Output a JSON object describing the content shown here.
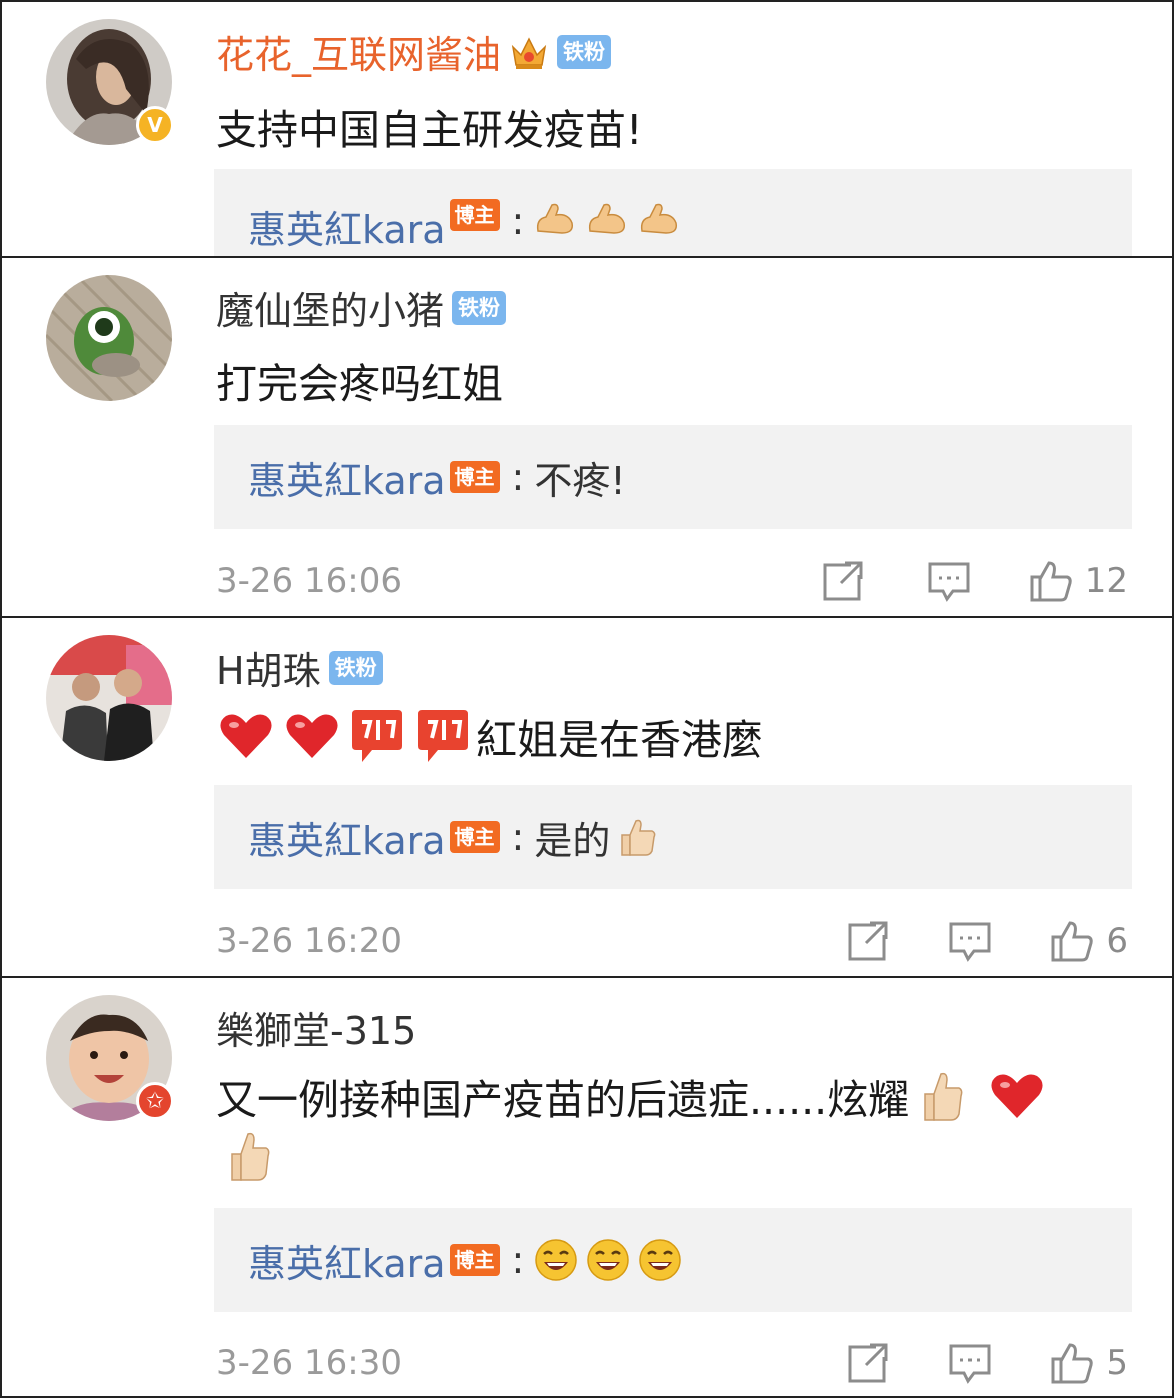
{
  "comments": [
    {
      "username": "花花_互联网酱油",
      "fan_badge": "铁粉",
      "text": "支持中国自主研发疫苗!",
      "reply": {
        "name": "惠英紅kara",
        "badge": "博主",
        "colon": ":",
        "text": ""
      }
    },
    {
      "username": "魔仙堡的小猪",
      "fan_badge": "铁粉",
      "text": "打完会疼吗红姐",
      "reply": {
        "name": "惠英紅kara",
        "badge": "博主",
        "colon": ":",
        "text": "不疼!"
      },
      "time": "3-26 16:06",
      "likes": "12"
    },
    {
      "username": "H胡珠",
      "fan_badge": "铁粉",
      "text": "紅姐是在香港麼",
      "reply": {
        "name": "惠英紅kara",
        "badge": "博主",
        "colon": ":",
        "text": "是的"
      },
      "time": "3-26 16:20",
      "likes": "6"
    },
    {
      "username": "樂獅堂-315",
      "text": "又一例接种国产疫苗的后遗症......炫耀",
      "reply": {
        "name": "惠英紅kara",
        "badge": "博主",
        "colon": ":",
        "text": ""
      },
      "time": "3-26 16:30",
      "likes": "5"
    }
  ],
  "colors": {
    "vip_name": "#e8632c",
    "reply_name": "#4a6ea9",
    "bozhu_badge": "#f26b22",
    "fan_badge": "#7bb6ee",
    "verified_badge": "#f5b324",
    "star_badge": "#e4452e"
  },
  "icons": [
    "crown-icon",
    "verified-v-icon",
    "share-icon",
    "comment-icon",
    "like-icon",
    "red-star-badge-icon"
  ]
}
